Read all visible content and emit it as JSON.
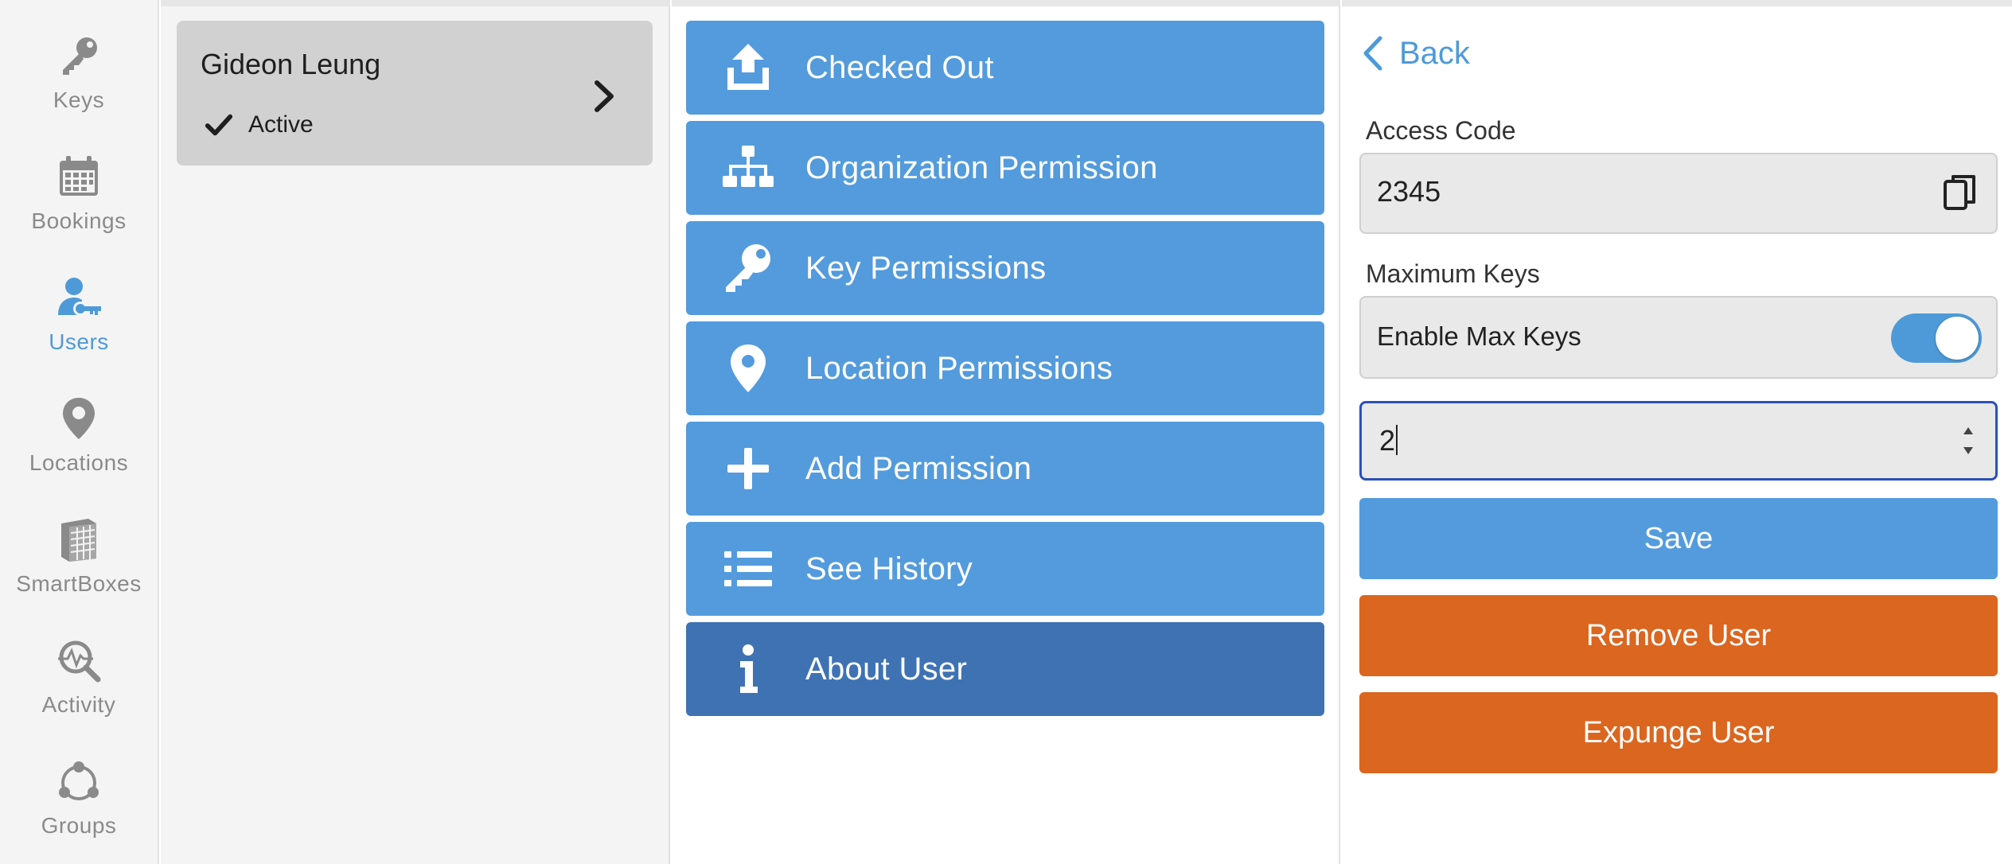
{
  "nav": {
    "items": [
      {
        "label": "Keys",
        "icon": "key-icon"
      },
      {
        "label": "Bookings",
        "icon": "calendar-icon"
      },
      {
        "label": "Users",
        "icon": "user-key-icon",
        "active": true
      },
      {
        "label": "Locations",
        "icon": "map-pin-icon"
      },
      {
        "label": "SmartBoxes",
        "icon": "smartbox-icon"
      },
      {
        "label": "Activity",
        "icon": "activity-icon"
      },
      {
        "label": "Groups",
        "icon": "groups-icon"
      }
    ]
  },
  "user_card": {
    "name": "Gideon Leung",
    "status": "Active"
  },
  "actions": [
    {
      "label": "Checked Out",
      "icon": "upload-icon"
    },
    {
      "label": "Organization Permission",
      "icon": "org-chart-icon"
    },
    {
      "label": "Key Permissions",
      "icon": "key-icon"
    },
    {
      "label": "Location Permissions",
      "icon": "map-pin-icon"
    },
    {
      "label": "Add Permission",
      "icon": "plus-icon"
    },
    {
      "label": "See History",
      "icon": "list-icon"
    },
    {
      "label": "About User",
      "icon": "info-icon",
      "selected": true
    }
  ],
  "detail": {
    "back_label": "Back",
    "access_code_label": "Access Code",
    "access_code_value": "2345",
    "max_keys_label": "Maximum Keys",
    "enable_max_keys_label": "Enable Max Keys",
    "enable_max_keys_on": true,
    "max_keys_value": "2",
    "save_label": "Save",
    "remove_label": "Remove User",
    "expunge_label": "Expunge User"
  },
  "colors": {
    "accent": "#4e9ad8",
    "action_button": "#539bdc",
    "action_button_selected": "#3e72b3",
    "danger": "#db6620",
    "focus_border": "#2c50b8"
  }
}
